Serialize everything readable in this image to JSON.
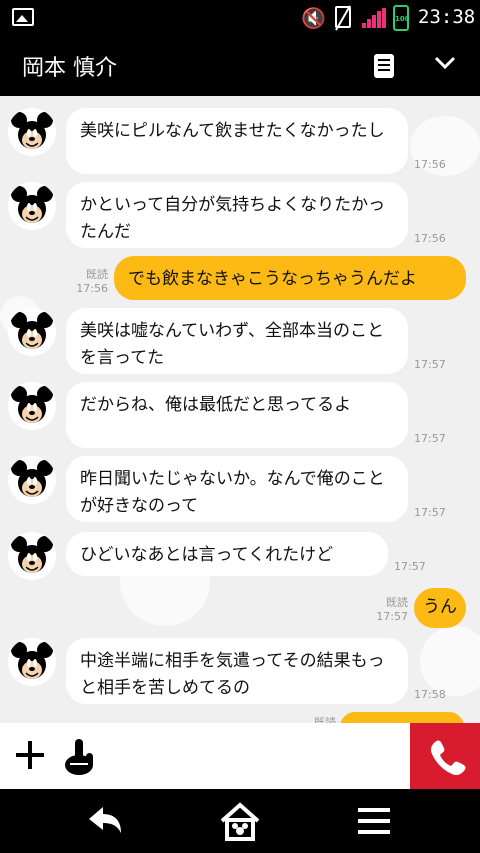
{
  "status_bar": {
    "time": "23:38",
    "battery": "100"
  },
  "header": {
    "contact_name": "岡本 慎介"
  },
  "messages": [
    {
      "side": "left",
      "text": "美咲にピルなんて飲ませたくなかったし",
      "time": "17:56"
    },
    {
      "side": "left",
      "text": "かといって自分が気持ちよくなりたかったんだ",
      "time": "17:56"
    },
    {
      "side": "right",
      "text": "でも飲まなきゃこうなっちゃうんだよ",
      "time": "17:56",
      "read": "既読"
    },
    {
      "side": "left",
      "text": "美咲は嘘なんていわず、全部本当のことを言ってた",
      "time": "17:57"
    },
    {
      "side": "left",
      "text": "だからね、俺は最低だと思ってるよ",
      "time": "17:57"
    },
    {
      "side": "left",
      "text": "昨日聞いたじゃないか。なんで俺のことが好きなのって",
      "time": "17:57"
    },
    {
      "side": "left",
      "text": "ひどいなあとは言ってくれたけど",
      "time": "17:57"
    },
    {
      "side": "right",
      "text": "うん",
      "time": "17:57",
      "read": "既読"
    },
    {
      "side": "left",
      "text": "中途半端に相手を気遣ってその結果もっと相手を苦しめてるの",
      "time": "17:58"
    }
  ],
  "partial_read": "既読",
  "icons": {
    "add": "plus-icon",
    "sticker": "hand-icon",
    "call": "phone-icon",
    "back": "back-icon",
    "home": "home-icon",
    "menu": "menu-icon"
  },
  "colors": {
    "right_bubble": "#fdb914",
    "call_button": "#d81b2e"
  }
}
